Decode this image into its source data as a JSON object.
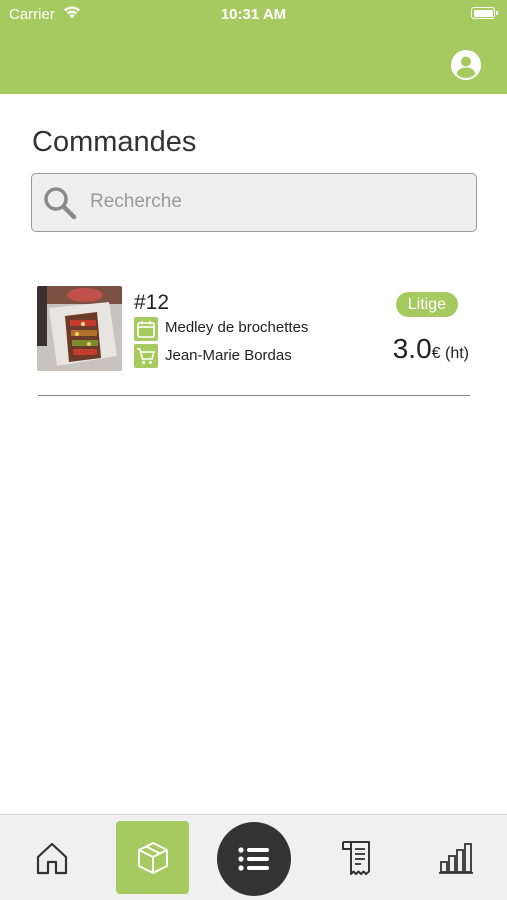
{
  "status_bar": {
    "carrier": "Carrier",
    "time": "10:31 AM"
  },
  "header": {
    "profile_icon": "account-circle-icon"
  },
  "page": {
    "title": "Commandes"
  },
  "search": {
    "placeholder": "Recherche",
    "value": ""
  },
  "orders": [
    {
      "number": "#12",
      "product": "Medley de brochettes",
      "customer": "Jean-Marie Bordas",
      "status": "Litige",
      "price": "3.0",
      "price_unit": "€ (ht)"
    }
  ],
  "tabbar": {
    "items": [
      {
        "icon": "home-icon"
      },
      {
        "icon": "package-icon",
        "active": true
      },
      {
        "icon": "list-icon"
      },
      {
        "icon": "receipt-icon"
      },
      {
        "icon": "bar-chart-icon"
      }
    ]
  },
  "colors": {
    "accent": "#a6ca5f",
    "dark": "#333333",
    "tabbar_bg": "#f0f0f0"
  }
}
